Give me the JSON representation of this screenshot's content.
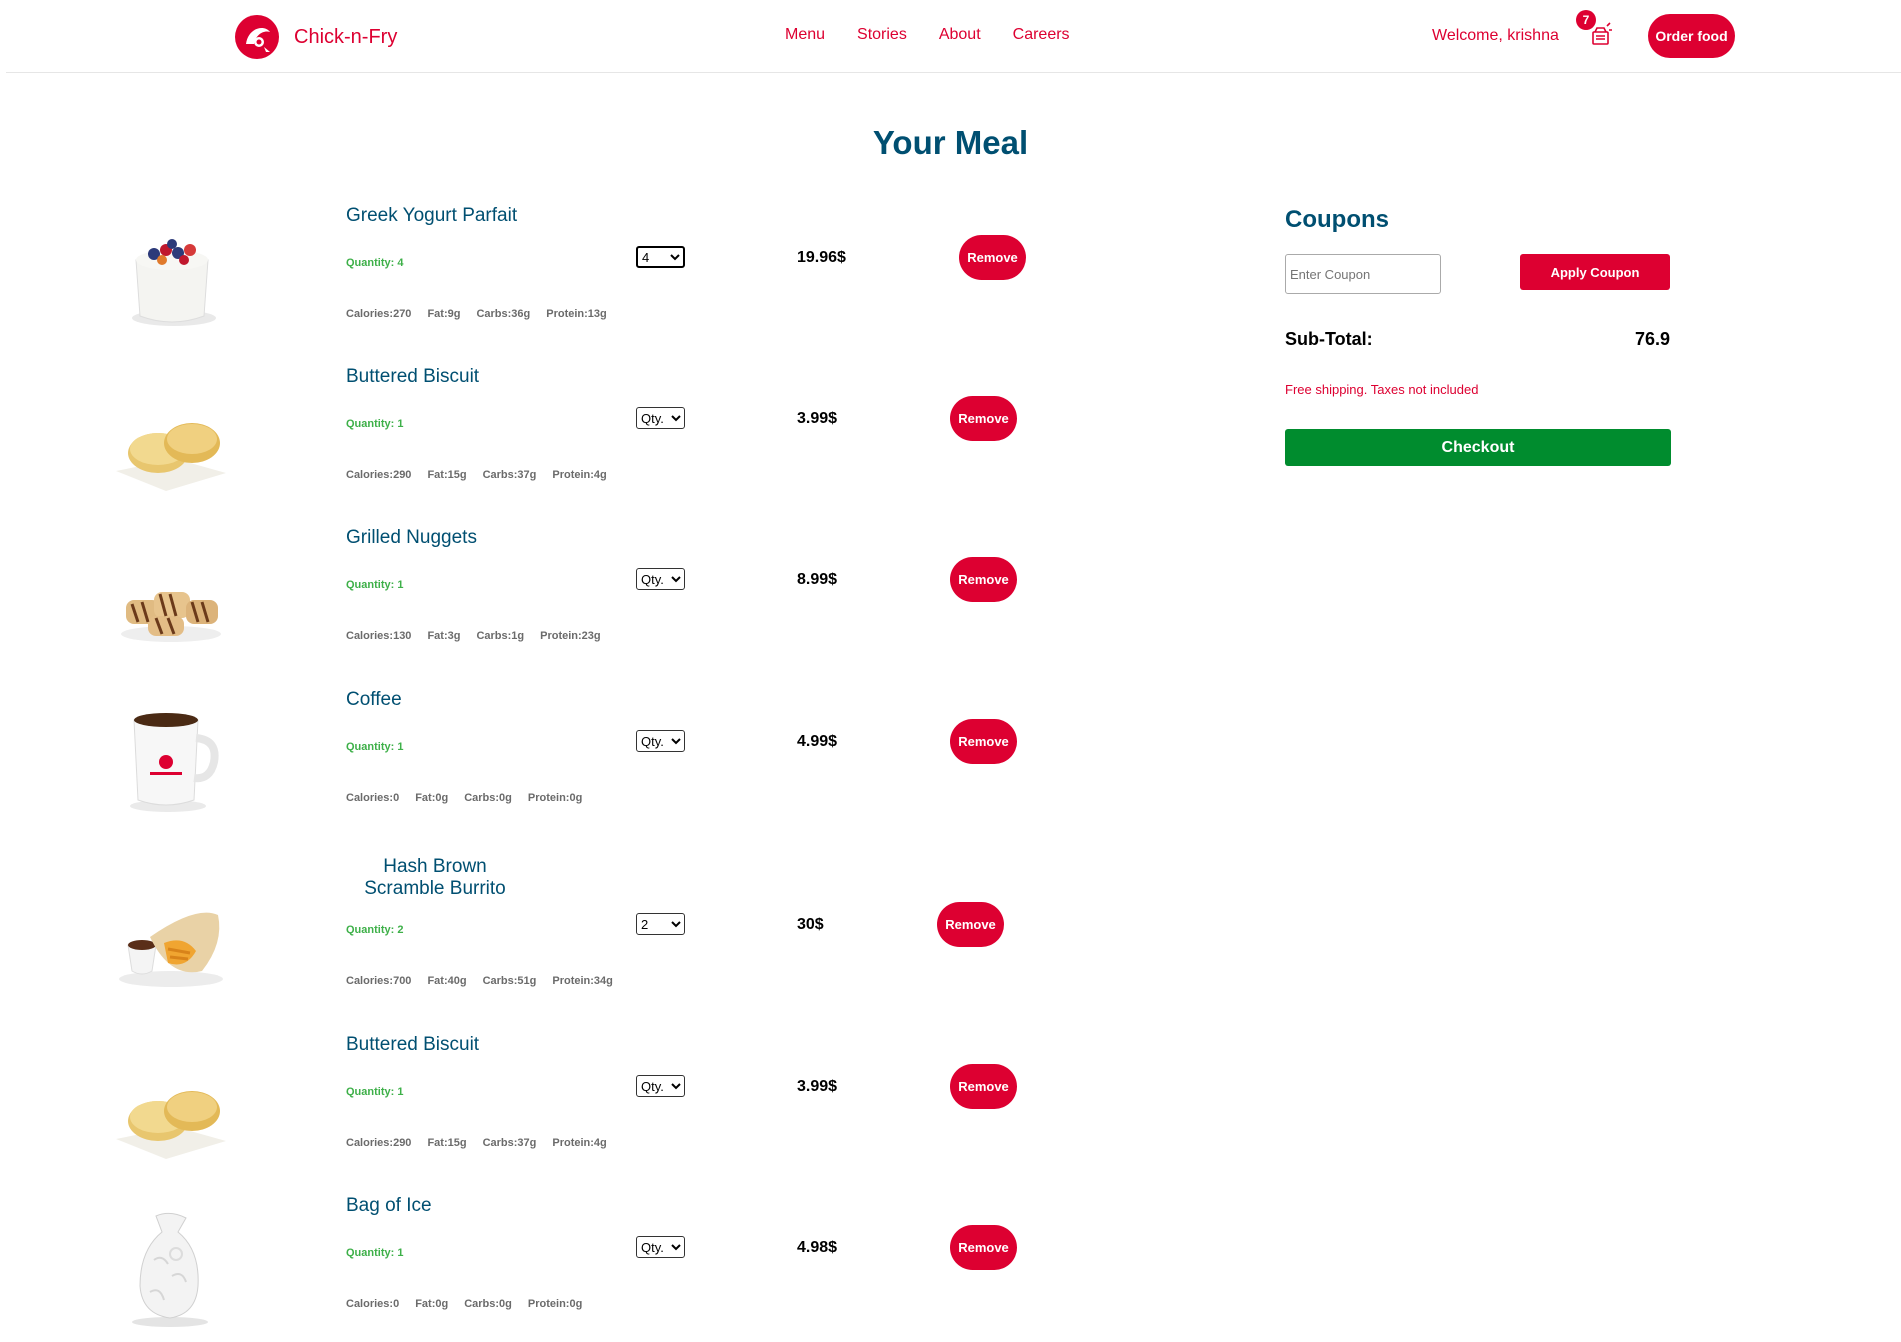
{
  "header": {
    "brand": "Chick-n-Fry",
    "nav": [
      "Menu",
      "Stories",
      "About",
      "Careers"
    ],
    "welcome": "Welcome, krishna",
    "cart_count": "7",
    "order_button": "Order food"
  },
  "title": "Your Meal",
  "items": [
    {
      "name": "Greek Yogurt Parfait",
      "quantity_label": "Quantity: 4",
      "qty_select": "4",
      "price": "19.96$",
      "remove": "Remove",
      "nutrition": [
        "Calories:270",
        "Fat:9g",
        "Carbs:36g",
        "Protein:13g"
      ]
    },
    {
      "name": "Buttered Biscuit",
      "quantity_label": "Quantity: 1",
      "qty_select": "Qty.",
      "price": "3.99$",
      "remove": "Remove",
      "nutrition": [
        "Calories:290",
        "Fat:15g",
        "Carbs:37g",
        "Protein:4g"
      ]
    },
    {
      "name": "Grilled Nuggets",
      "quantity_label": "Quantity: 1",
      "qty_select": "Qty.",
      "price": "8.99$",
      "remove": "Remove",
      "nutrition": [
        "Calories:130",
        "Fat:3g",
        "Carbs:1g",
        "Protein:23g"
      ]
    },
    {
      "name": "Coffee",
      "quantity_label": "Quantity: 1",
      "qty_select": "Qty.",
      "price": "4.99$",
      "remove": "Remove",
      "nutrition": [
        "Calories:0",
        "Fat:0g",
        "Carbs:0g",
        "Protein:0g"
      ]
    },
    {
      "name_line1": "Hash Brown",
      "name_line2": "Scramble Burrito",
      "quantity_label": "Quantity: 2",
      "qty_select": "2",
      "price": "30$",
      "remove": "Remove",
      "nutrition": [
        "Calories:700",
        "Fat:40g",
        "Carbs:51g",
        "Protein:34g"
      ]
    },
    {
      "name": "Buttered Biscuit",
      "quantity_label": "Quantity: 1",
      "qty_select": "Qty.",
      "price": "3.99$",
      "remove": "Remove",
      "nutrition": [
        "Calories:290",
        "Fat:15g",
        "Carbs:37g",
        "Protein:4g"
      ]
    },
    {
      "name": "Bag of Ice",
      "quantity_label": "Quantity: 1",
      "qty_select": "Qty.",
      "price": "4.98$",
      "remove": "Remove",
      "nutrition": [
        "Calories:0",
        "Fat:0g",
        "Carbs:0g",
        "Protein:0g"
      ]
    }
  ],
  "sidebar": {
    "coupons_title": "Coupons",
    "coupon_placeholder": "Enter Coupon",
    "apply_button": "Apply Coupon",
    "subtotal_label": "Sub-Total:",
    "subtotal_value": "76.9",
    "shipping_note": "Free shipping. Taxes not included",
    "checkout_button": "Checkout"
  },
  "colors": {
    "brand_red": "#dd0031",
    "heading_blue": "#004f71",
    "quantity_green": "#3eb049",
    "checkout_green": "#008c2e"
  }
}
